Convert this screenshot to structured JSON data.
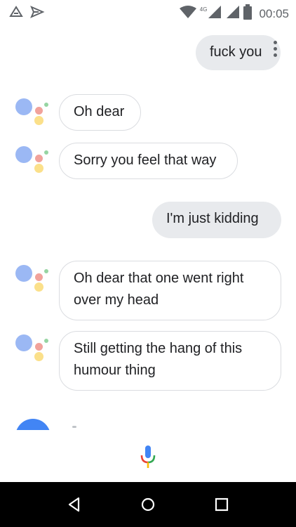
{
  "status_bar": {
    "network_label": "4G",
    "time": "00:05"
  },
  "conversation": {
    "messages": [
      {
        "role": "user",
        "text": "fuck you"
      },
      {
        "role": "assistant",
        "text": "Oh dear"
      },
      {
        "role": "assistant",
        "text": "Sorry you feel that way"
      },
      {
        "role": "user",
        "text": "I'm just kidding"
      },
      {
        "role": "assistant",
        "text": "Oh dear that one went right over my head"
      },
      {
        "role": "assistant",
        "text": "Still getting the hang of this humour thing"
      }
    ]
  },
  "icons": {
    "status_left": [
      "notification-icon",
      "send-icon"
    ],
    "status_right": [
      "wifi-icon",
      "signal-icon",
      "battery-icon"
    ],
    "input": "mic-icon",
    "nav": [
      "back-icon",
      "home-icon",
      "recents-icon"
    ]
  },
  "colors": {
    "user_bubble": "#e8eaed",
    "assistant_bubble_border": "#dadce0",
    "google_blue": "#4285f4",
    "google_red": "#ea4335",
    "google_yellow": "#fbbc05",
    "google_green": "#34a853",
    "nav_bar": "#000000"
  }
}
